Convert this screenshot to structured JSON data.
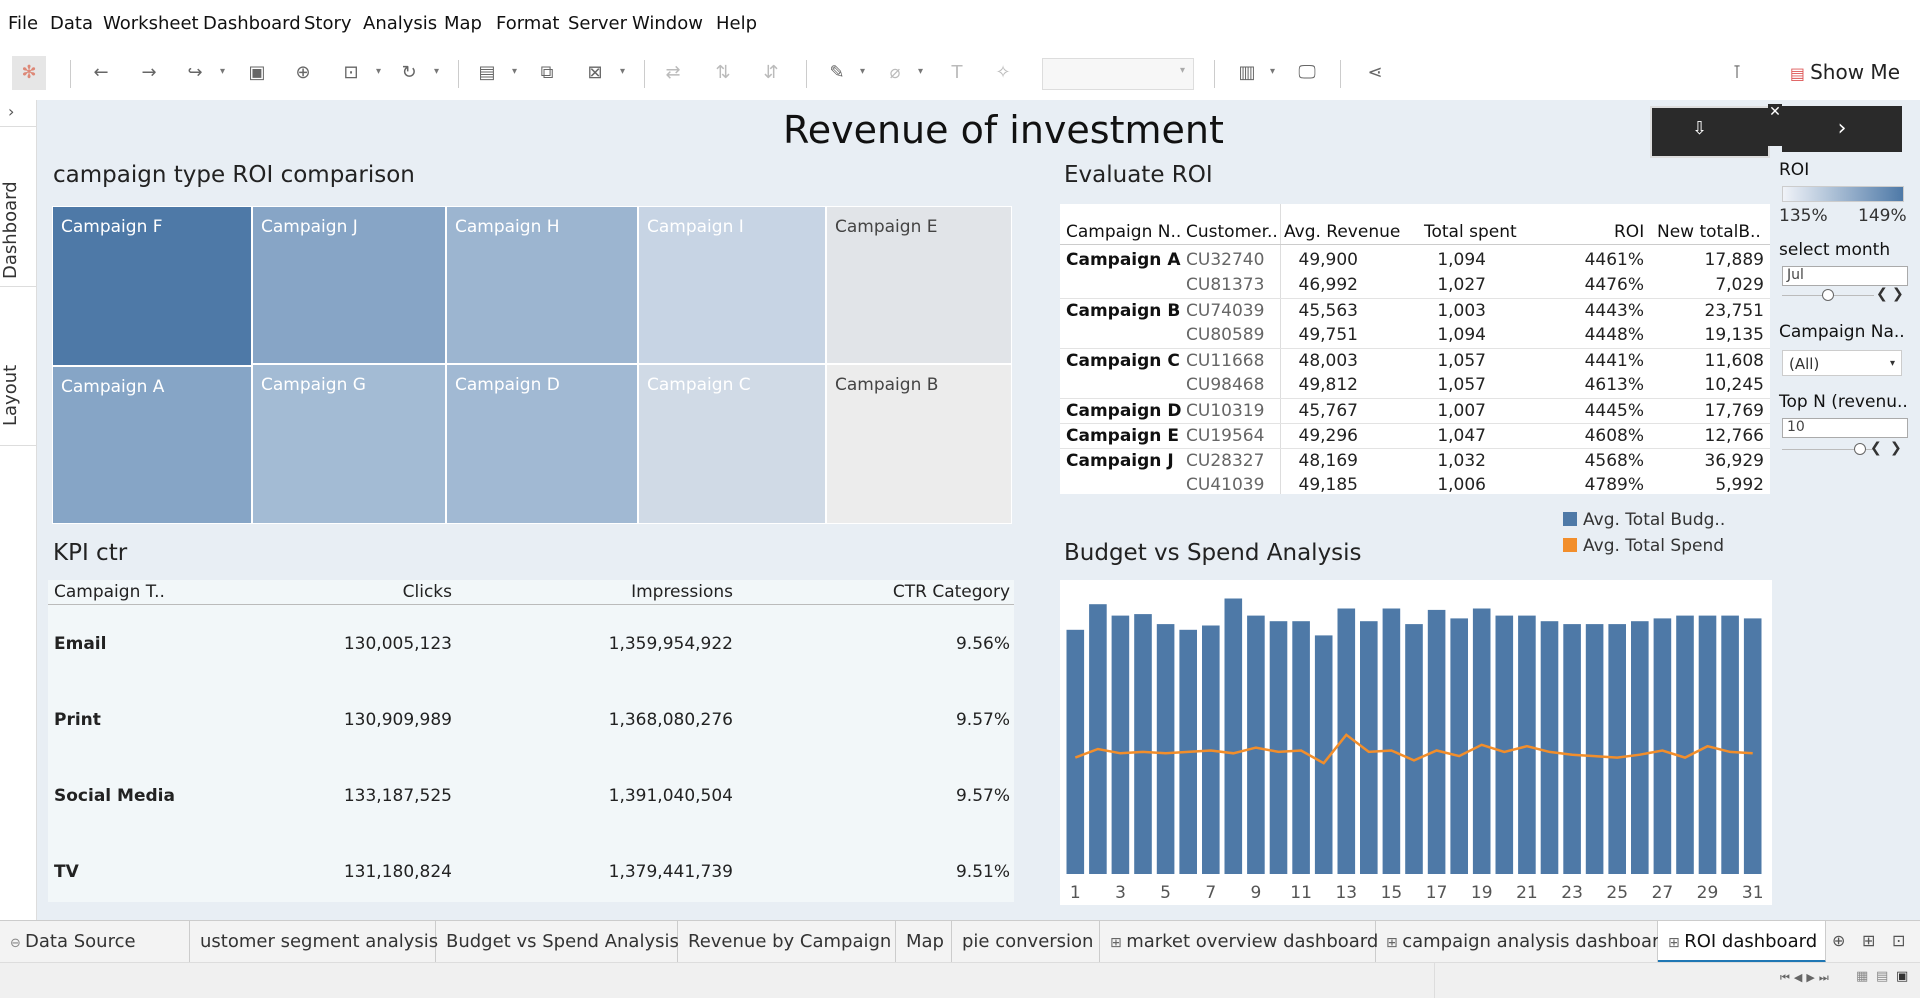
{
  "menu": [
    "File",
    "Data",
    "Worksheet",
    "Dashboard",
    "Story",
    "Analysis",
    "Map",
    "Format",
    "Server",
    "Window",
    "Help"
  ],
  "toolbar": {
    "show_me": "Show Me"
  },
  "left_tabs": {
    "dashboard": "Dashboard",
    "layout": "Layout"
  },
  "dashboard": {
    "title": "Revenue of investment"
  },
  "treemap": {
    "title": "campaign type ROI comparison",
    "tiles": [
      "Campaign F",
      "Campaign J",
      "Campaign H",
      "Campaign I",
      "Campaign E",
      "Campaign A",
      "Campaign G",
      "Campaign D",
      "Campaign C",
      "Campaign B"
    ]
  },
  "roi_table": {
    "title": "Evaluate ROI",
    "headers": [
      "Campaign N..",
      "Customer..",
      "Avg. Revenue",
      "Total spent",
      "ROI",
      "New totalB.."
    ],
    "rows": [
      {
        "campaign": "Campaign A",
        "customer": "CU32740",
        "revenue": "49,900",
        "spent": "1,094",
        "roi": "4461%",
        "budget": "17,889"
      },
      {
        "campaign": "",
        "customer": "CU81373",
        "revenue": "46,992",
        "spent": "1,027",
        "roi": "4476%",
        "budget": "7,029"
      },
      {
        "campaign": "Campaign B",
        "customer": "CU74039",
        "revenue": "45,563",
        "spent": "1,003",
        "roi": "4443%",
        "budget": "23,751"
      },
      {
        "campaign": "",
        "customer": "CU80589",
        "revenue": "49,751",
        "spent": "1,094",
        "roi": "4448%",
        "budget": "19,135"
      },
      {
        "campaign": "Campaign C",
        "customer": "CU11668",
        "revenue": "48,003",
        "spent": "1,057",
        "roi": "4441%",
        "budget": "11,608"
      },
      {
        "campaign": "",
        "customer": "CU98468",
        "revenue": "49,812",
        "spent": "1,057",
        "roi": "4613%",
        "budget": "10,245"
      },
      {
        "campaign": "Campaign D",
        "customer": "CU10319",
        "revenue": "45,767",
        "spent": "1,007",
        "roi": "4445%",
        "budget": "17,769"
      },
      {
        "campaign": "Campaign E",
        "customer": "CU19564",
        "revenue": "49,296",
        "spent": "1,047",
        "roi": "4608%",
        "budget": "12,766"
      },
      {
        "campaign": "Campaign J",
        "customer": "CU28327",
        "revenue": "48,169",
        "spent": "1,032",
        "roi": "4568%",
        "budget": "36,929"
      },
      {
        "campaign": "",
        "customer": "CU41039",
        "revenue": "49,185",
        "spent": "1,006",
        "roi": "4789%",
        "budget": "5,992"
      }
    ]
  },
  "filters": {
    "roi_label": "ROI",
    "roi_min": "135%",
    "roi_max": "149%",
    "month_label": "select month",
    "month_value": "Jul",
    "campaign_label": "Campaign Na..",
    "campaign_value": "(All)",
    "topn_label": "Top N (revenu..",
    "topn_value": "10"
  },
  "kpi": {
    "title": "KPI ctr",
    "headers": [
      "Campaign T..",
      "Clicks",
      "Impressions",
      "CTR Category"
    ],
    "rows": [
      {
        "type": "Email",
        "clicks": "130,005,123",
        "impressions": "1,359,954,922",
        "ctr": "9.56%"
      },
      {
        "type": "Print",
        "clicks": "130,909,989",
        "impressions": "1,368,080,276",
        "ctr": "9.57%"
      },
      {
        "type": "Social Media",
        "clicks": "133,187,525",
        "impressions": "1,391,040,504",
        "ctr": "9.57%"
      },
      {
        "type": "TV",
        "clicks": "131,180,824",
        "impressions": "1,379,441,739",
        "ctr": "9.51%"
      }
    ]
  },
  "chart_data": {
    "type": "bar",
    "title": "Budget vs Spend Analysis",
    "x": [
      1,
      2,
      3,
      4,
      5,
      6,
      7,
      8,
      9,
      10,
      11,
      12,
      13,
      14,
      15,
      16,
      17,
      18,
      19,
      20,
      21,
      22,
      23,
      24,
      25,
      26,
      27,
      28,
      29,
      30,
      31
    ],
    "x_tick_labels": [
      "1",
      "3",
      "5",
      "7",
      "9",
      "11",
      "13",
      "15",
      "17",
      "19",
      "21",
      "23",
      "25",
      "27",
      "29",
      "31"
    ],
    "series": [
      {
        "name": "Avg. Total Budg..",
        "type": "bar",
        "color": "#4e79a7",
        "values": [
          172,
          190,
          182,
          183,
          176,
          172,
          175,
          194,
          182,
          178,
          178,
          168,
          187,
          178,
          187,
          176,
          186,
          180,
          187,
          182,
          182,
          178,
          176,
          176,
          176,
          178,
          180,
          182,
          182,
          182,
          180
        ]
      },
      {
        "name": "Avg. Total Spend",
        "type": "line",
        "color": "#f28e2b",
        "values": [
          82,
          88,
          85,
          86,
          85,
          86,
          87,
          85,
          89,
          86,
          87,
          78,
          98,
          86,
          87,
          80,
          87,
          83,
          91,
          86,
          90,
          86,
          84,
          83,
          82,
          84,
          87,
          82,
          90,
          86,
          85
        ]
      }
    ],
    "ylim": [
      0,
      200
    ],
    "legend": "top-right",
    "grid": false
  },
  "sheet_tabs": [
    "Data Source",
    "ustomer segment analysis",
    "Budget vs Spend Analysis",
    "Revenue  by Campaign",
    "Map",
    "pie conversion",
    "market overview dashboard",
    "campaign analysis dashboard",
    "ROI dashboard"
  ]
}
